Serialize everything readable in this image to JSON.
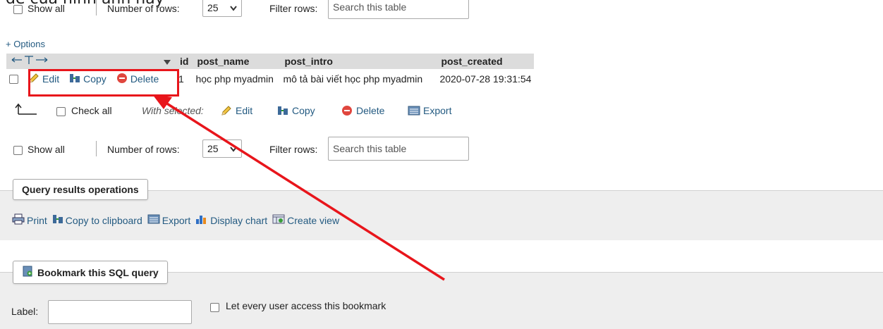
{
  "caption_text": "đề của hình ảnh này",
  "top_controls": {
    "show_all": "Show all",
    "number_of_rows_label": "Number of rows:",
    "rows_value": "25",
    "filter_label": "Filter rows:",
    "search_placeholder": "Search this table"
  },
  "options_link": "+ Options",
  "table": {
    "columns": [
      "id",
      "post_name",
      "post_intro",
      "post_created"
    ],
    "row": {
      "edit": "Edit",
      "copy": "Copy",
      "delete": "Delete",
      "id": "1",
      "post_name": "học php myadmin",
      "post_intro": "mô tả bài viết học php myadmin",
      "post_created": "2020-07-28 19:31:54"
    }
  },
  "bulk": {
    "check_all": "Check all",
    "with_selected": "With selected:",
    "edit": "Edit",
    "copy": "Copy",
    "delete": "Delete",
    "export": "Export"
  },
  "bottom_controls": {
    "show_all": "Show all",
    "number_of_rows_label": "Number of rows:",
    "rows_value": "25",
    "filter_label": "Filter rows:",
    "search_placeholder": "Search this table"
  },
  "query_ops": {
    "legend": "Query results operations",
    "print": "Print",
    "copy_clipboard": "Copy to clipboard",
    "export": "Export",
    "display_chart": "Display chart",
    "create_view": "Create view"
  },
  "bookmark": {
    "legend": "Bookmark this SQL query",
    "label": "Label:",
    "let_every_user": "Let every user access this bookmark"
  },
  "colors": {
    "annotation_red": "#e8151b",
    "link_blue": "#235a81",
    "header_gray": "#dcdcdc",
    "panel_gray": "#eeeeee"
  }
}
